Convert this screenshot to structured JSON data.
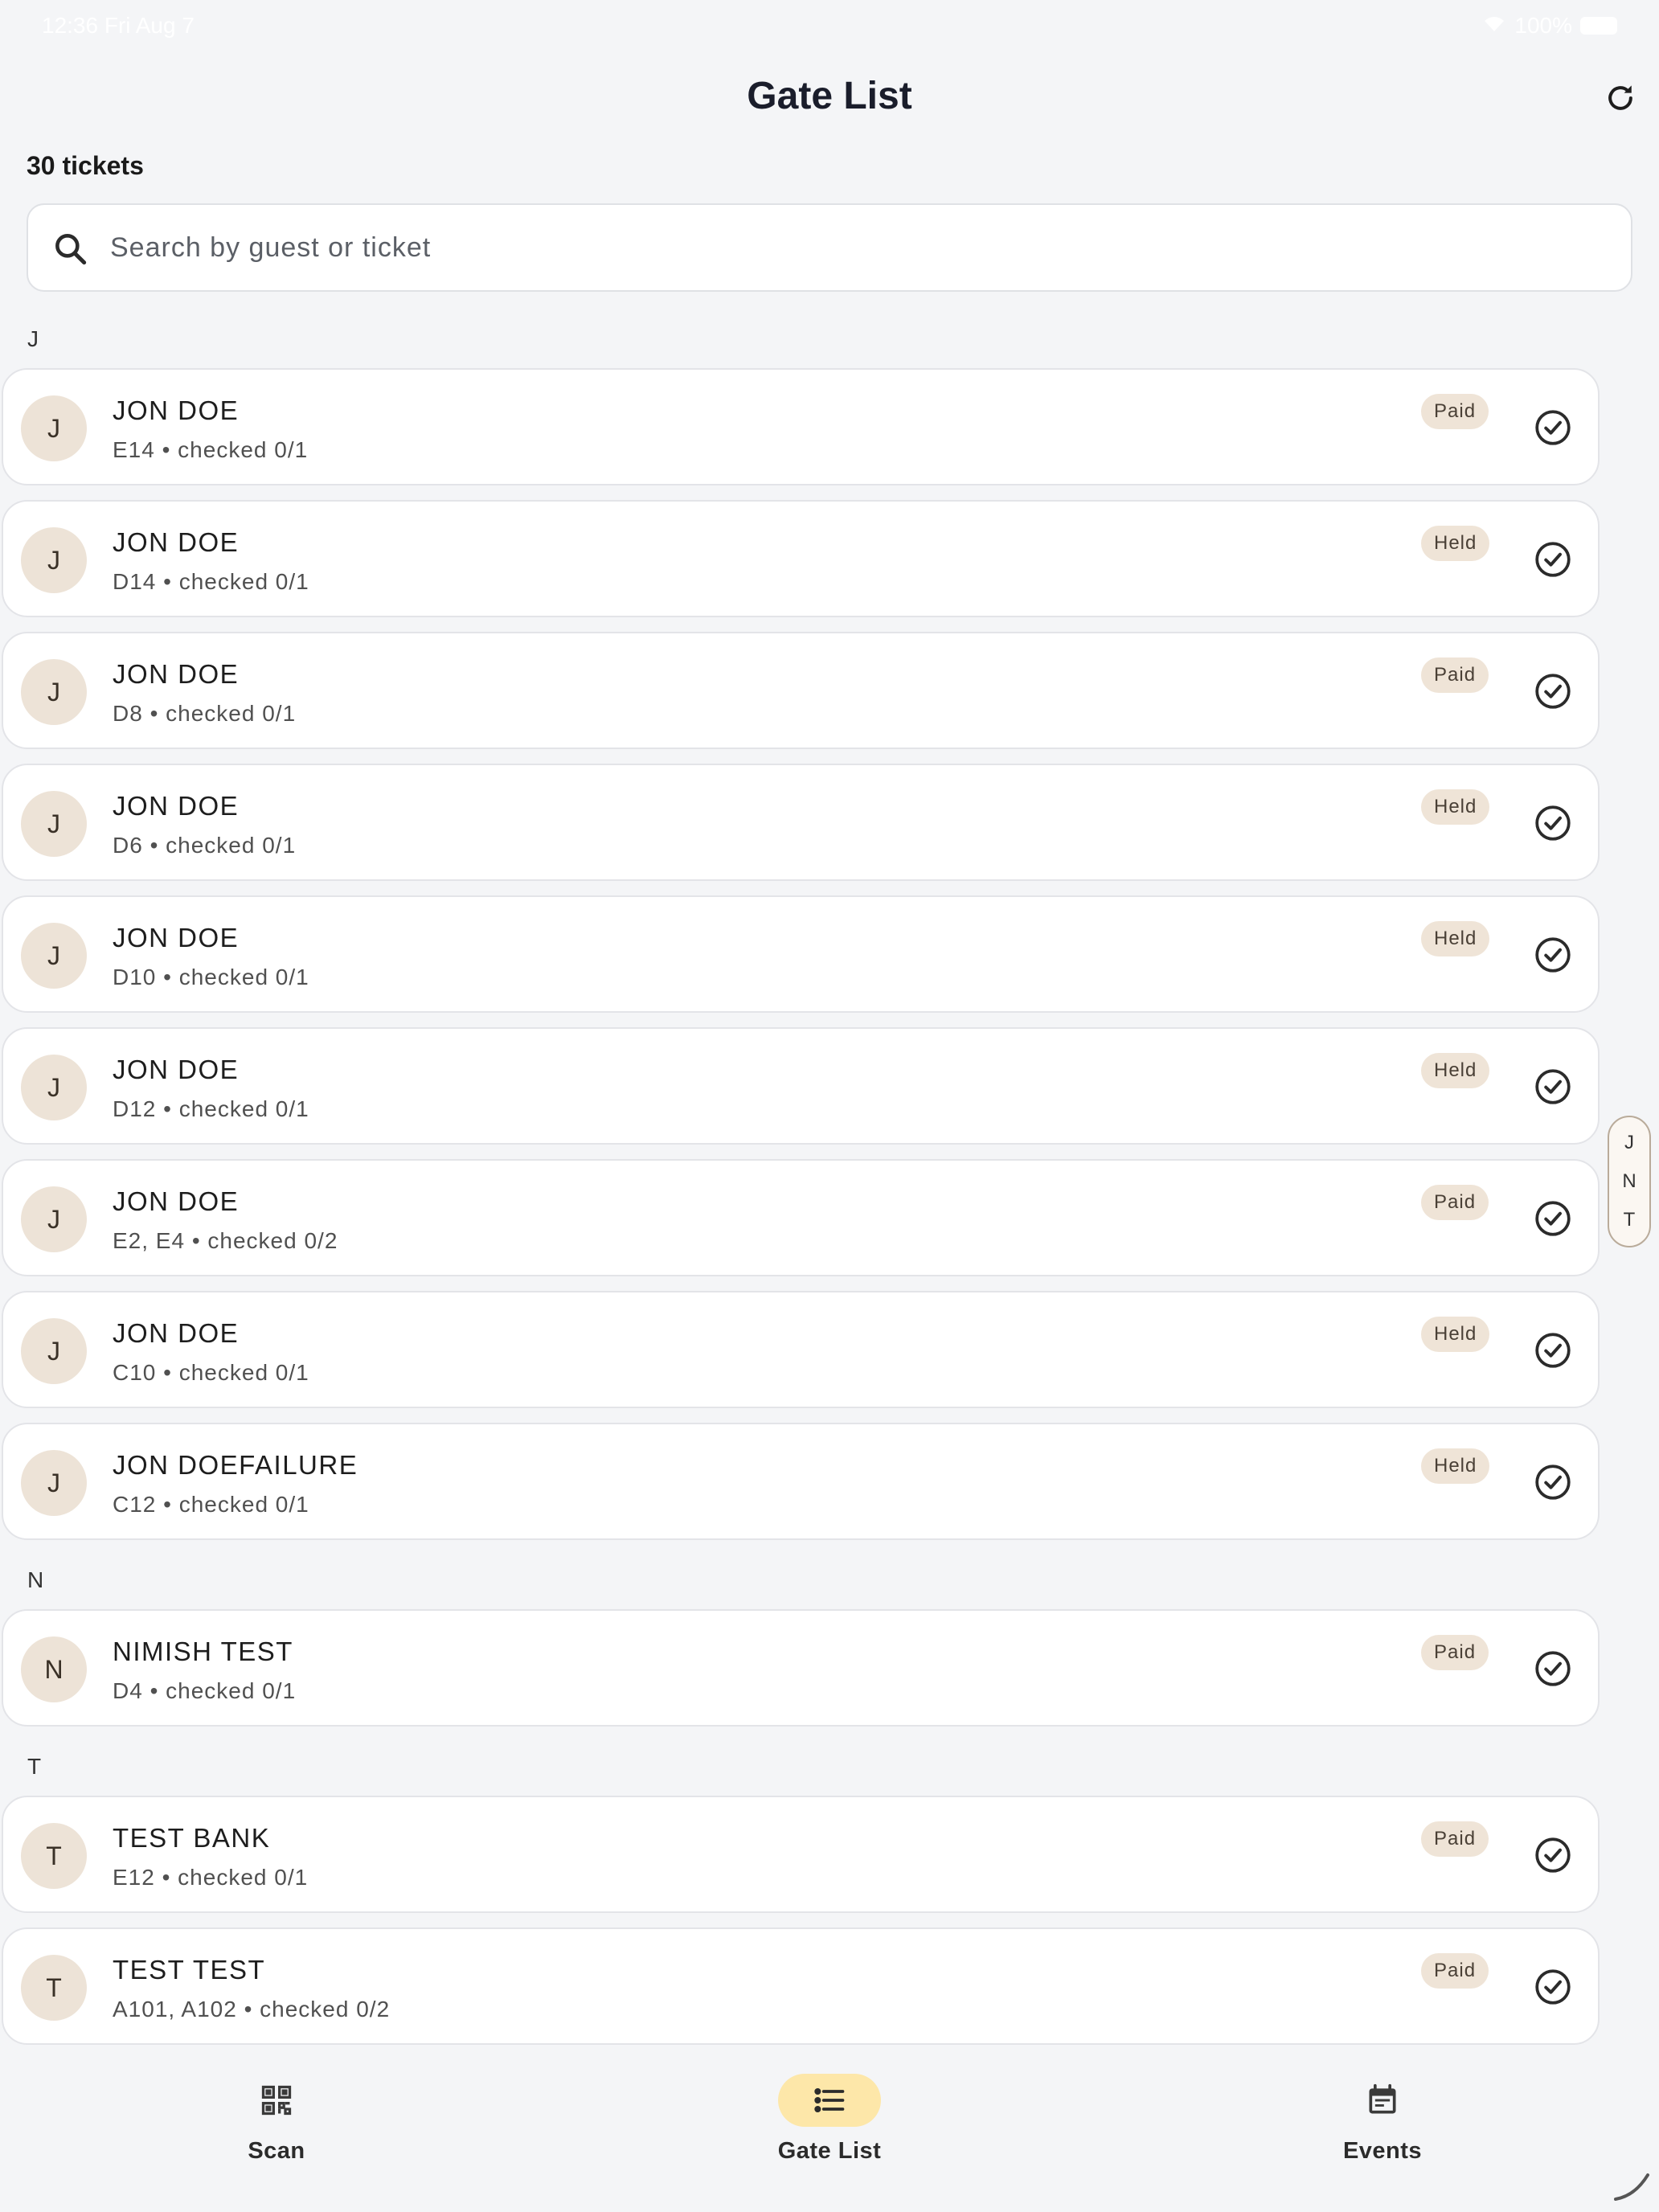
{
  "status_bar": {
    "time": "12:36  Fri Aug 7",
    "battery": "100%"
  },
  "header": {
    "title": "Gate List"
  },
  "ticket_count": "30 tickets",
  "search": {
    "placeholder": "Search by guest or ticket",
    "value": ""
  },
  "sections": [
    {
      "letter": "J",
      "items": [
        {
          "initial": "J",
          "name": "JON DOE",
          "detail": "E14 • checked 0/1",
          "status": "Paid"
        },
        {
          "initial": "J",
          "name": "JON DOE",
          "detail": "D14 • checked 0/1",
          "status": "Held"
        },
        {
          "initial": "J",
          "name": "JON DOE",
          "detail": "D8 • checked 0/1",
          "status": "Paid"
        },
        {
          "initial": "J",
          "name": "JON DOE",
          "detail": "D6 • checked 0/1",
          "status": "Held"
        },
        {
          "initial": "J",
          "name": "JON DOE",
          "detail": "D10 • checked 0/1",
          "status": "Held"
        },
        {
          "initial": "J",
          "name": "JON DOE",
          "detail": "D12 • checked 0/1",
          "status": "Held"
        },
        {
          "initial": "J",
          "name": "JON DOE",
          "detail": "E2, E4 • checked 0/2",
          "status": "Paid"
        },
        {
          "initial": "J",
          "name": "JON DOE",
          "detail": "C10 • checked 0/1",
          "status": "Held"
        },
        {
          "initial": "J",
          "name": "JON DOEFAILURE",
          "detail": "C12 • checked 0/1",
          "status": "Held"
        }
      ]
    },
    {
      "letter": "N",
      "items": [
        {
          "initial": "N",
          "name": "NIMISH TEST",
          "detail": "D4 • checked 0/1",
          "status": "Paid"
        }
      ]
    },
    {
      "letter": "T",
      "items": [
        {
          "initial": "T",
          "name": "TEST BANK",
          "detail": "E12 • checked 0/1",
          "status": "Paid"
        },
        {
          "initial": "T",
          "name": "TEST TEST",
          "detail": "A101, A102 • checked 0/2",
          "status": "Paid"
        }
      ]
    }
  ],
  "index_letters": [
    "J",
    "N",
    "T"
  ],
  "tabs": [
    {
      "label": "Scan",
      "icon": "qr-code-icon",
      "active": false
    },
    {
      "label": "Gate List",
      "icon": "list-icon",
      "active": true
    },
    {
      "label": "Events",
      "icon": "calendar-icon",
      "active": false
    }
  ],
  "colors": {
    "accent": "#fde7a9",
    "badge": "#efe4d7",
    "avatar": "#ede3d7",
    "background": "#f4f5f7"
  }
}
